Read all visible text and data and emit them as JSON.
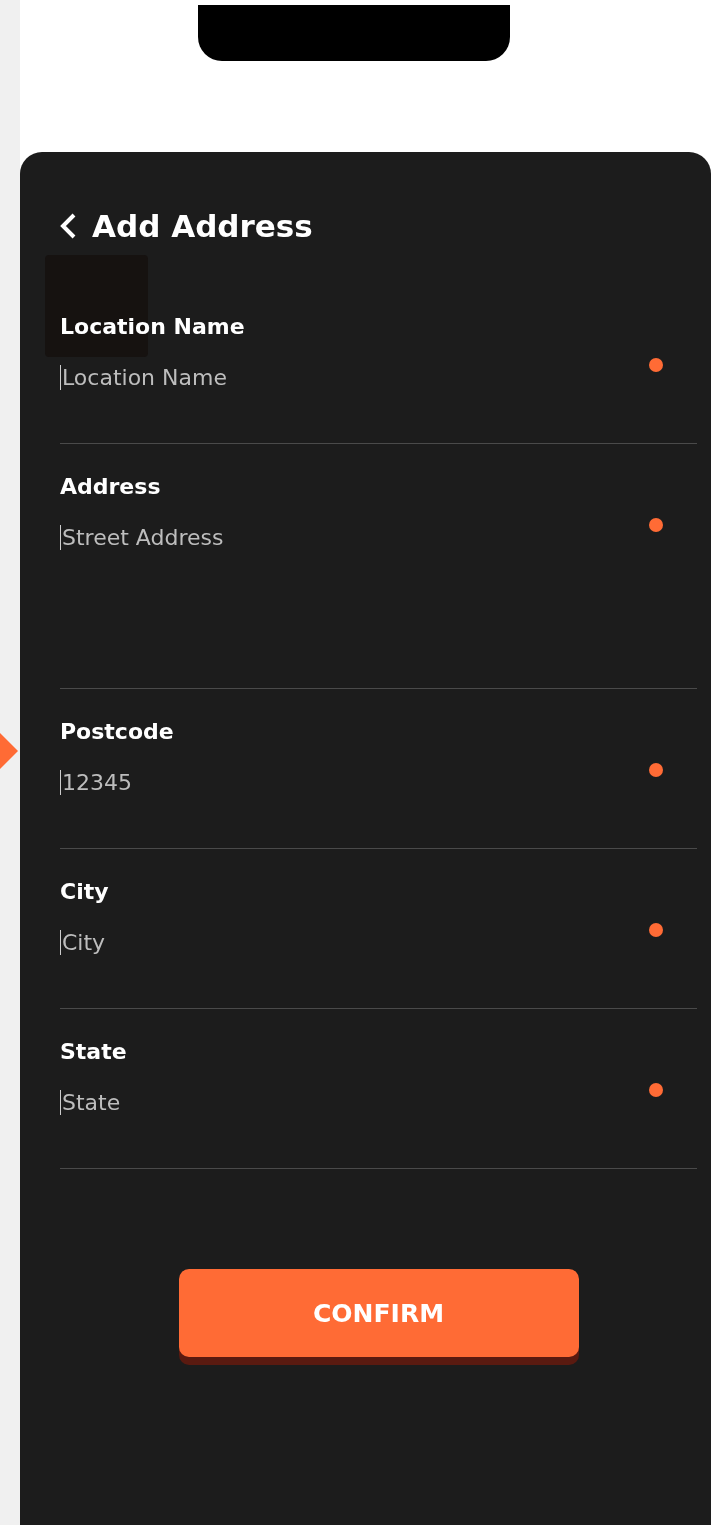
{
  "sheet": {
    "title": "Add Address"
  },
  "fields": [
    {
      "label": "Location Name",
      "placeholder": "Location Name",
      "required": true
    },
    {
      "label": "Address",
      "placeholder": "Street Address",
      "required": true
    },
    {
      "label": "Postcode",
      "placeholder": "12345",
      "required": true
    },
    {
      "label": "City",
      "placeholder": "City",
      "required": true
    },
    {
      "label": "State",
      "placeholder": "State",
      "required": true
    }
  ],
  "confirm_button": {
    "label": "CONFIRM"
  }
}
